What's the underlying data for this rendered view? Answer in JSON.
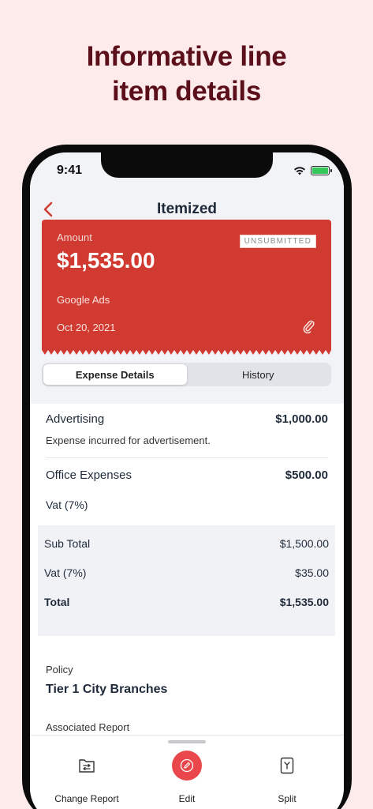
{
  "headline": {
    "line1": "Informative line",
    "line2": "item details"
  },
  "status": {
    "time": "9:41"
  },
  "nav": {
    "title": "Itemized"
  },
  "card": {
    "amount_label": "Amount",
    "amount": "$1,535.00",
    "badge": "UNSUBMITTED",
    "merchant": "Google Ads",
    "date": "Oct 20, 2021"
  },
  "tabs": [
    {
      "label": "Expense Details",
      "active": true
    },
    {
      "label": "History",
      "active": false
    }
  ],
  "items": [
    {
      "name": "Advertising",
      "amount": "$1,000.00",
      "description": "Expense incurred for advertisement."
    },
    {
      "name": "Office Expenses",
      "amount": "$500.00",
      "tax": "Vat (7%)"
    }
  ],
  "summary": {
    "subtotal_label": "Sub Total",
    "subtotal": "$1,500.00",
    "vat_label": "Vat (7%)",
    "vat": "$35.00",
    "total_label": "Total",
    "total": "$1,535.00"
  },
  "policy": {
    "label": "Policy",
    "value": "Tier 1 City Branches"
  },
  "associated_report": {
    "label": "Associated Report"
  },
  "toolbar": {
    "change_report": "Change Report",
    "edit": "Edit",
    "split": "Split"
  },
  "colors": {
    "accent": "#d03a30",
    "edit_button": "#e9474b",
    "headline": "#5a0f1a",
    "background": "#fdeaea"
  }
}
